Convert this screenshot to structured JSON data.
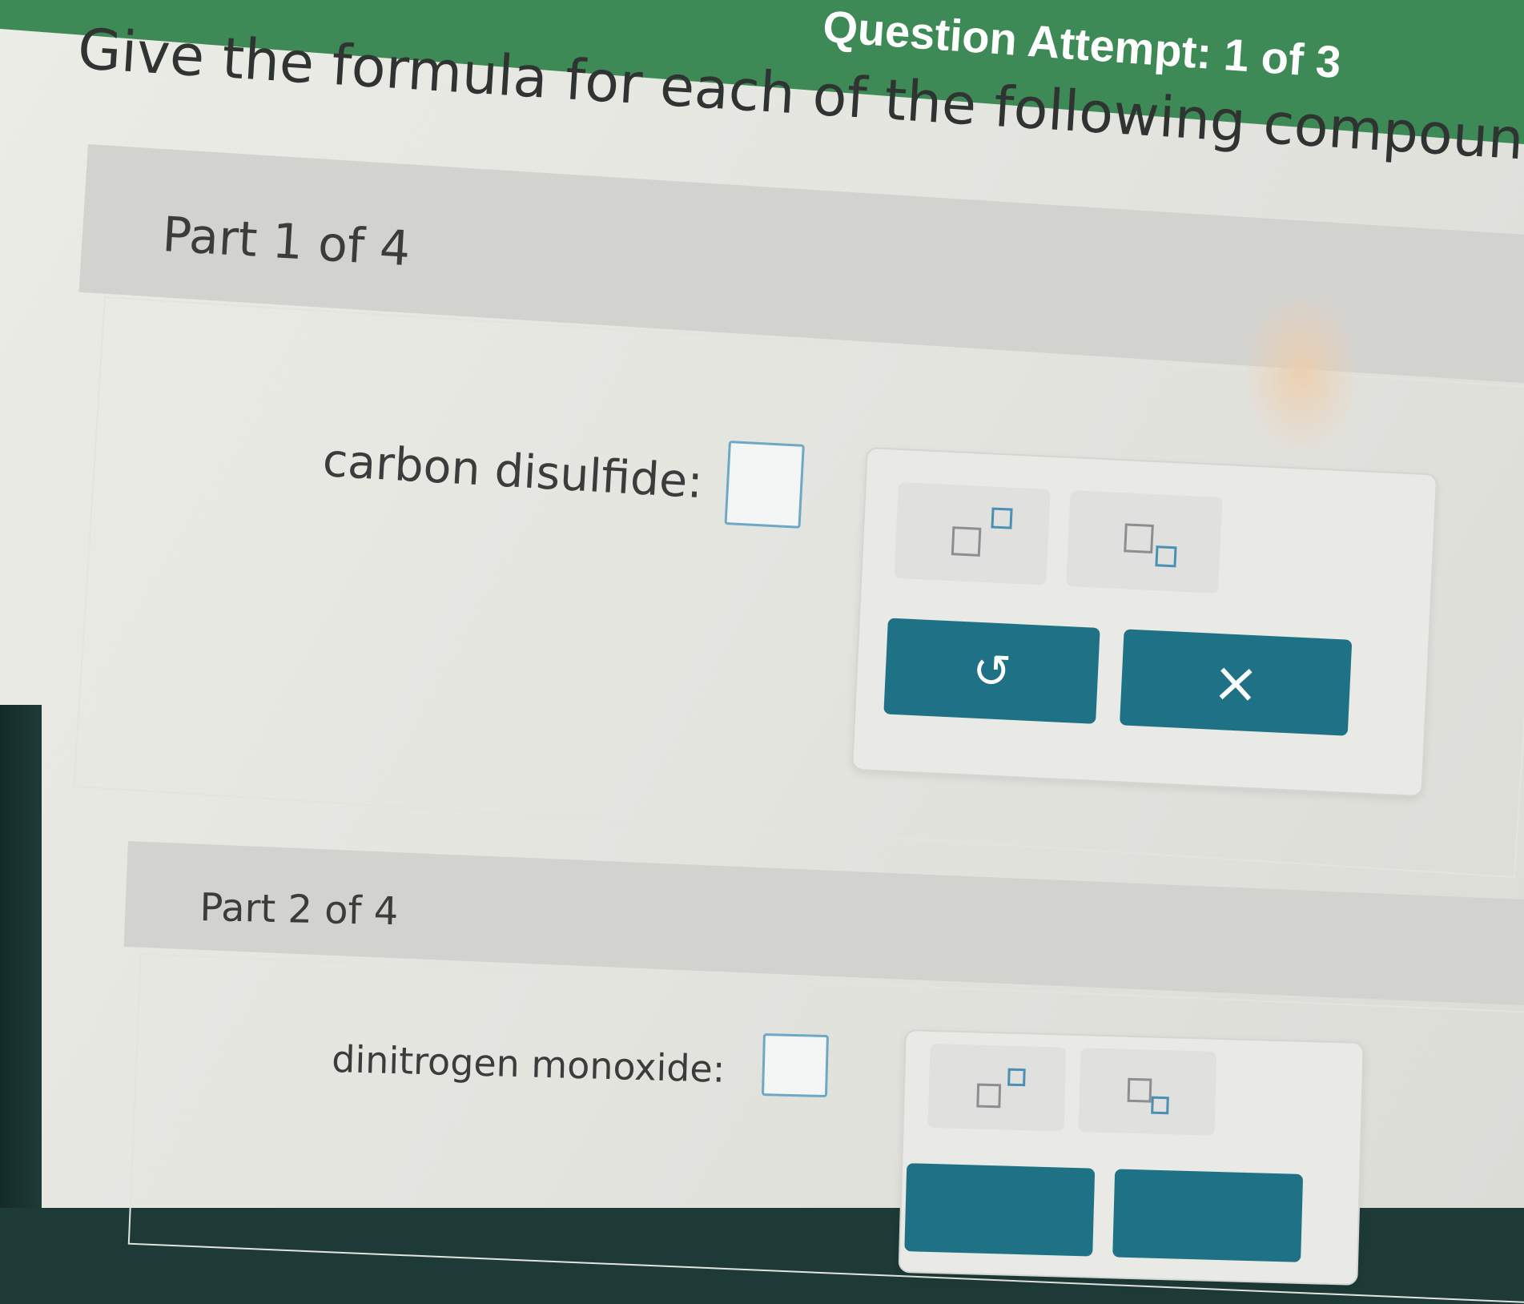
{
  "header": {
    "attempt_text": "Question Attempt: 1 of 3"
  },
  "question": {
    "prompt": "Give the formula for each of the following compounds:"
  },
  "parts": [
    {
      "title": "Part 1 of 4",
      "compound_label": "carbon disulfide:",
      "answer_value": "",
      "undo_icon": "↺",
      "clear_icon": "×"
    },
    {
      "title": "Part 2 of 4",
      "compound_label": "dinitrogen monoxide:",
      "answer_value": ""
    }
  ],
  "colors": {
    "header_green": "#3d8a56",
    "action_teal": "#1f7285",
    "input_border": "#6fa8c6"
  },
  "icons": [
    "superscript-template-icon",
    "subscript-template-icon",
    "undo-icon",
    "clear-icon"
  ]
}
